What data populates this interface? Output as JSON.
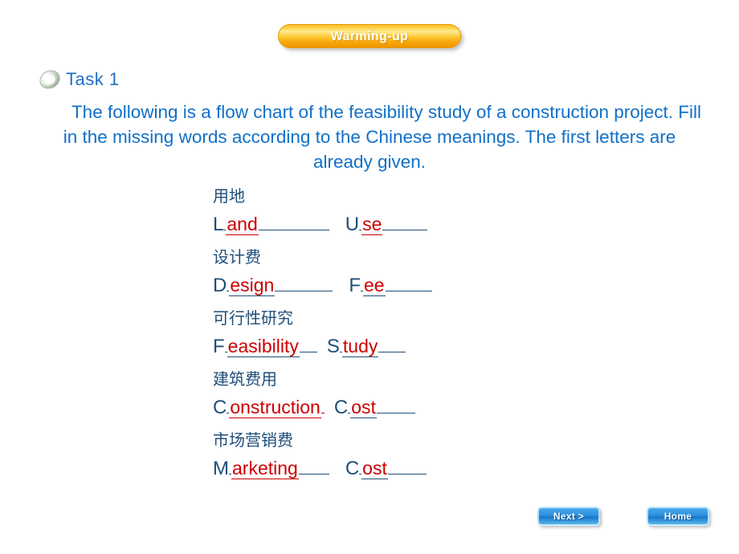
{
  "slide": {
    "banner_label": "Warming-up",
    "task_label": "Task 1",
    "bullet_icon": "glossy-oval-bullet-icon",
    "instructions": "The following is a flow chart of the feasibility study of a construction project. Fill in the missing words according to the Chinese meanings. The first letters are already given."
  },
  "colors": {
    "heading_blue": "#1070c8",
    "dark_blue": "#1f4e79",
    "answer_red": "#cc0000",
    "banner_gold": "#fdcb36",
    "button_blue": "#2e90dd",
    "background": "#ffffff"
  },
  "exercise": {
    "items": [
      {
        "chinese": "用地",
        "left": {
          "first_letter": "L",
          "fill": "and"
        },
        "right": {
          "first_letter": "U",
          "fill": "se"
        }
      },
      {
        "chinese": "设计费",
        "left": {
          "first_letter": "D",
          "fill": "esign"
        },
        "right": {
          "first_letter": "F",
          "fill": "ee"
        }
      },
      {
        "chinese": "可行性研究",
        "left": {
          "first_letter": "F",
          "fill": "easibility"
        },
        "right": {
          "first_letter": "S",
          "fill": "tudy"
        }
      },
      {
        "chinese": "建筑费用",
        "left": {
          "first_letter": "C",
          "fill": "onstruction"
        },
        "right": {
          "first_letter": "C",
          "fill": "ost"
        }
      },
      {
        "chinese": "市场营销费",
        "left": {
          "first_letter": "M",
          "fill": "arketing"
        },
        "right": {
          "first_letter": "C",
          "fill": "ost"
        }
      }
    ]
  },
  "footer": {
    "next_label": "Next >",
    "home_label": "Home"
  }
}
